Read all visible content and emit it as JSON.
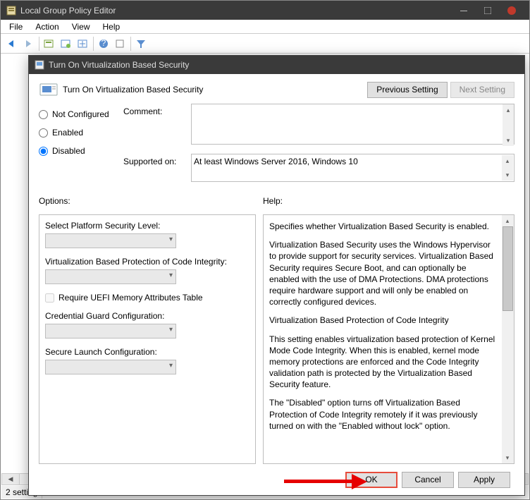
{
  "parent": {
    "title": "Local Group Policy Editor",
    "menu": {
      "file": "File",
      "action": "Action",
      "view": "View",
      "help": "Help"
    },
    "status": "2 setting"
  },
  "dialog": {
    "title": "Turn On Virtualization Based Security",
    "heading": "Turn On Virtualization Based Security",
    "prev_btn": "Previous Setting",
    "next_btn": "Next Setting",
    "radio": {
      "not_configured": "Not Configured",
      "enabled": "Enabled",
      "disabled": "Disabled"
    },
    "comment_label": "Comment:",
    "supported_label": "Supported on:",
    "supported_text": "At least Windows Server 2016, Windows 10",
    "options_label": "Options:",
    "help_label": "Help:",
    "options": {
      "platform_level": "Select Platform Security Level:",
      "code_integrity": "Virtualization Based Protection of Code Integrity:",
      "uefi_check": "Require UEFI Memory Attributes Table",
      "cred_guard": "Credential Guard Configuration:",
      "secure_launch": "Secure Launch Configuration:"
    },
    "help": {
      "p1": "Specifies whether Virtualization Based Security is enabled.",
      "p2": "Virtualization Based Security uses the Windows Hypervisor to provide support for security services. Virtualization Based Security requires Secure Boot, and can optionally be enabled with the use of DMA Protections. DMA protections require hardware support and will only be enabled on correctly configured devices.",
      "p3": "Virtualization Based Protection of Code Integrity",
      "p4": "This setting enables virtualization based protection of Kernel Mode Code Integrity. When this is enabled, kernel mode memory protections are enforced and the Code Integrity validation path is protected by the Virtualization Based Security feature.",
      "p5": "The \"Disabled\" option turns off Virtualization Based Protection of Code Integrity remotely if it was previously turned on with the \"Enabled without lock\" option."
    },
    "ok": "OK",
    "cancel": "Cancel",
    "apply": "Apply"
  }
}
